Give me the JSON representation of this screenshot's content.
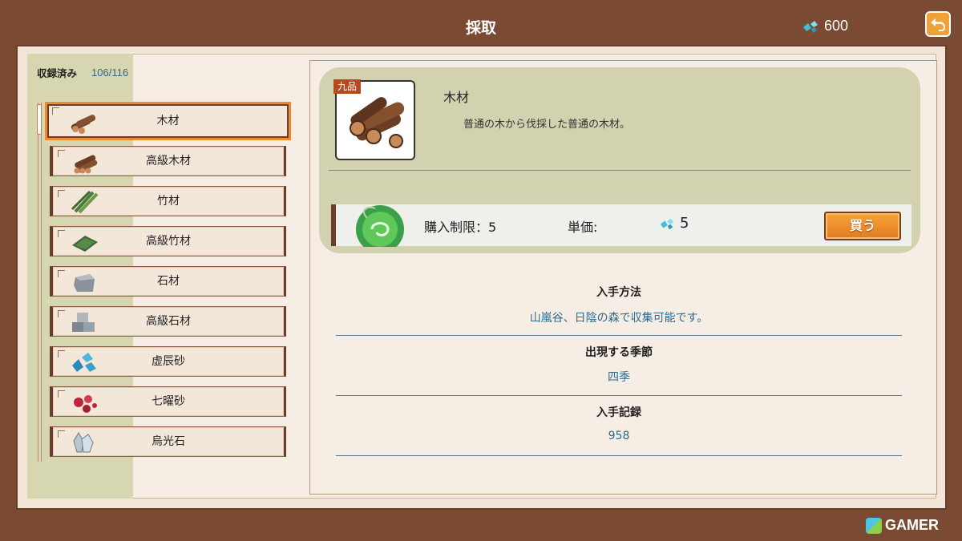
{
  "header": {
    "title": "採取",
    "currency_value": "600"
  },
  "collection": {
    "label": "収録済み",
    "count": "106/116"
  },
  "items": [
    {
      "label": "木材",
      "icon": "wood-logs-icon"
    },
    {
      "label": "高級木材",
      "icon": "premium-wood-icon"
    },
    {
      "label": "竹材",
      "icon": "bamboo-icon"
    },
    {
      "label": "高級竹材",
      "icon": "premium-bamboo-icon"
    },
    {
      "label": "石材",
      "icon": "stone-icon"
    },
    {
      "label": "高級石材",
      "icon": "premium-stone-icon"
    },
    {
      "label": "虚辰砂",
      "icon": "blue-ore-icon"
    },
    {
      "label": "七曜砂",
      "icon": "red-ore-icon"
    },
    {
      "label": "烏光石",
      "icon": "crystal-icon"
    }
  ],
  "detail": {
    "grade": "九品",
    "name": "木材",
    "description": "普通の木から伐採した普通の木材。"
  },
  "purchase": {
    "limit": "購入制限：5",
    "price_label": "単価:",
    "price_value": "5",
    "buy_label": "買う"
  },
  "info": [
    {
      "title": "入手方法",
      "value": "山嵐谷、日陰の森で収集可能です。"
    },
    {
      "title": "出現する季節",
      "value": "四季"
    },
    {
      "title": "入手記録",
      "value": "958"
    }
  ],
  "watermark": "GAMER",
  "colors": {
    "accent": "#f08a30",
    "frame": "#7a4a33",
    "value_text": "#2f6a8a"
  }
}
